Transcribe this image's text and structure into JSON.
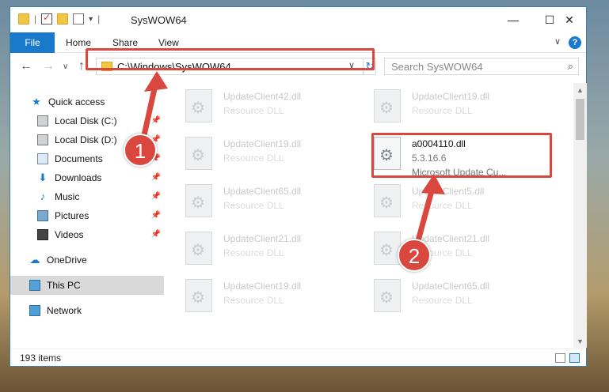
{
  "window": {
    "title": "SysWOW64",
    "controls": {
      "minimize": "—",
      "maximize": "☐",
      "close": "✕"
    }
  },
  "ribbon": {
    "file_tab": "File",
    "tabs": [
      "Home",
      "Share",
      "View"
    ],
    "expand_icon": "chevron-down-icon",
    "help_icon": "?"
  },
  "navigation": {
    "back": "←",
    "forward": "→",
    "recent": "∨",
    "up": "↑",
    "address": "C:\\Windows\\SysWOW64",
    "refresh": "↻",
    "dropdown": "∨",
    "search_placeholder": "Search SysWOW64",
    "search_icon": "⌕"
  },
  "nav_pane": {
    "items": [
      {
        "label": "Quick access",
        "icon": "star-icon",
        "pinned": false
      },
      {
        "label": "Local Disk (C:)",
        "icon": "disk-icon",
        "pinned": true
      },
      {
        "label": "Local Disk (D:)",
        "icon": "disk-icon",
        "pinned": true
      },
      {
        "label": "Documents",
        "icon": "documents-icon",
        "pinned": true
      },
      {
        "label": "Downloads",
        "icon": "download-icon",
        "pinned": true
      },
      {
        "label": "Music",
        "icon": "music-icon",
        "pinned": true
      },
      {
        "label": "Pictures",
        "icon": "pictures-icon",
        "pinned": true
      },
      {
        "label": "Videos",
        "icon": "videos-icon",
        "pinned": true
      },
      {
        "label": "OneDrive",
        "icon": "cloud-icon",
        "pinned": false
      },
      {
        "label": "This PC",
        "icon": "computer-icon",
        "pinned": false,
        "selected": true
      },
      {
        "label": "Network",
        "icon": "network-icon",
        "pinned": false
      }
    ]
  },
  "files": {
    "left_column": [
      {
        "name": "UpdateClient42.dll",
        "desc": "Resource DLL"
      },
      {
        "name": "UpdateClient19.dll",
        "desc": "Resource DLL"
      },
      {
        "name": "UpdateClient65.dll",
        "desc": "Resource DLL"
      },
      {
        "name": "UpdateClient21.dll",
        "desc": "Resource DLL"
      },
      {
        "name": "UpdateClient19.dll",
        "desc": "Resource DLL"
      }
    ],
    "right_column": [
      {
        "name": "UpdateClient19.dll",
        "desc": "Resource DLL"
      },
      {
        "name": "UpdateClient5.dll",
        "desc": "Resource DLL"
      },
      {
        "name": "UpdateClient21.dll",
        "desc": "Resource DLL"
      },
      {
        "name": "UpdateClient65.dll",
        "desc": "Resource DLL"
      }
    ],
    "highlighted": {
      "name": "a0004110.dll",
      "version": "5.3.16.6",
      "desc": "Microsoft Update Cu..."
    }
  },
  "status": {
    "count": "193 items"
  },
  "annotations": {
    "step1": "1",
    "step2": "2",
    "color": "#d9473f"
  }
}
